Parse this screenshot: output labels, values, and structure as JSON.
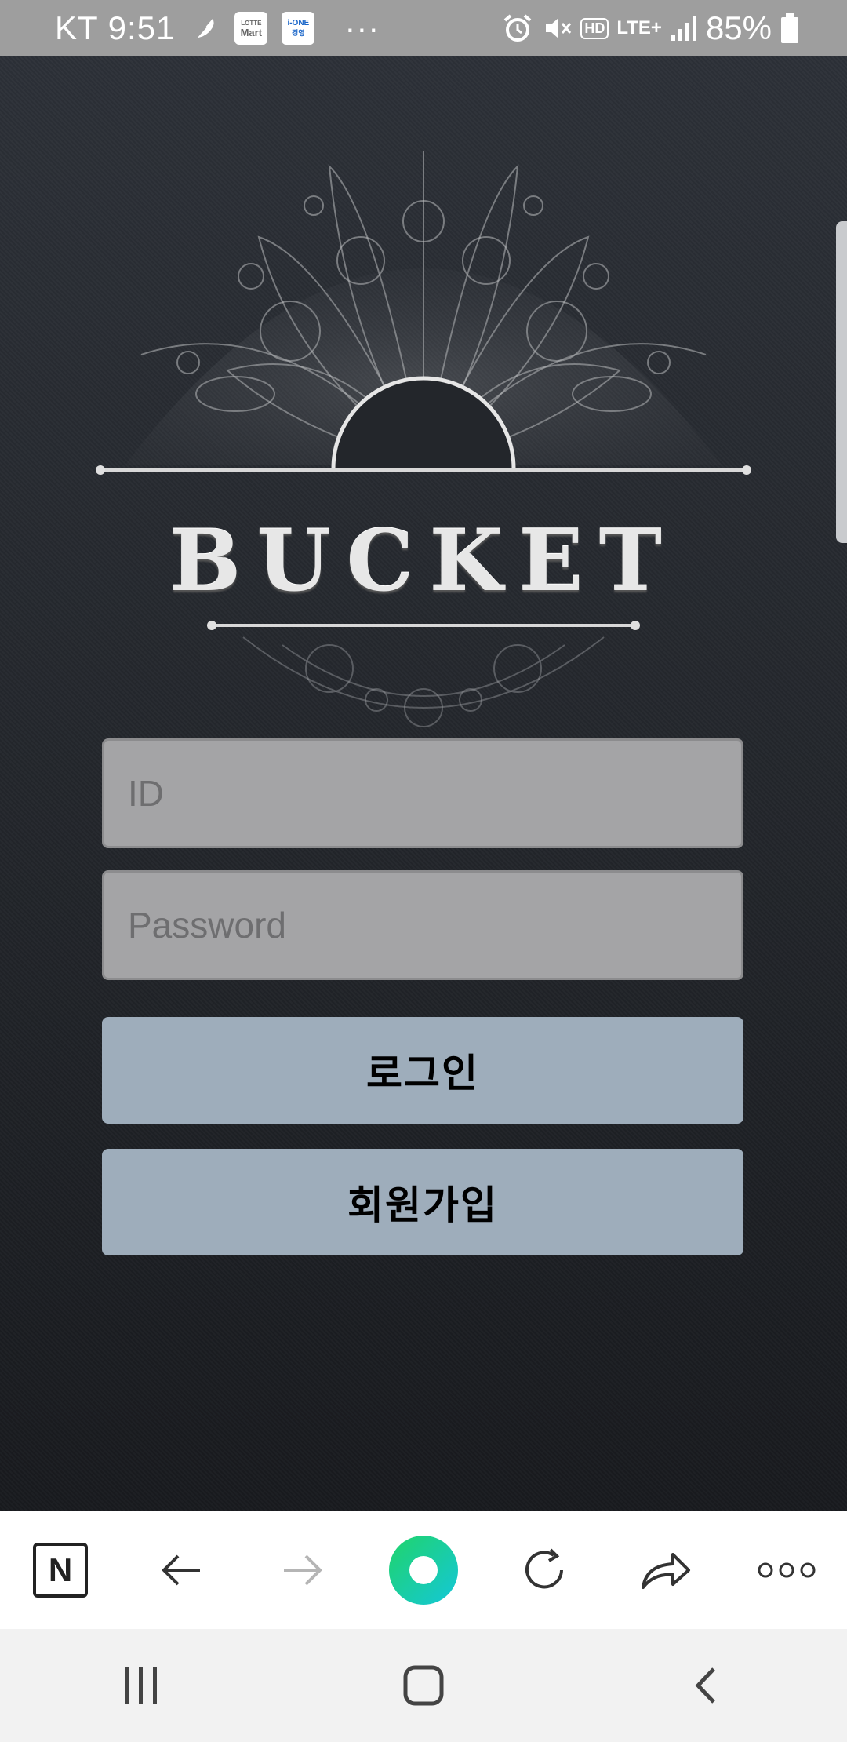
{
  "status_bar": {
    "carrier_time": "KT 9:51",
    "app_badge_lotte_line1": "LOTTE",
    "app_badge_lotte_line2": "Mart",
    "app_badge_ione_line1": "i-ONE",
    "app_badge_ione_line2": "경영",
    "more": "···",
    "hd": "HD",
    "network": "LTE+",
    "battery": "85%",
    "icons": [
      "feather-icon",
      "alarm-icon",
      "mute-icon",
      "signal-icon",
      "battery-icon"
    ]
  },
  "logo": {
    "brand": "BUCKET"
  },
  "login_form": {
    "id_placeholder": "ID",
    "password_placeholder": "Password",
    "login_label": "로그인",
    "signup_label": "회원가입"
  },
  "browser_toolbar": {
    "items": [
      "naver-home-icon",
      "back-arrow-icon",
      "forward-arrow-icon",
      "green-dot-icon",
      "refresh-icon",
      "share-icon",
      "more-icon"
    ],
    "naver_letter": "N"
  },
  "nav_bar": {
    "items": [
      "recents-icon",
      "home-icon",
      "back-icon"
    ]
  },
  "colors": {
    "status_bar": "#9e9e9e",
    "field_bg": "#a4a4a6",
    "button_bg": "#9eadbb",
    "accent_green": "#1fd38a"
  }
}
